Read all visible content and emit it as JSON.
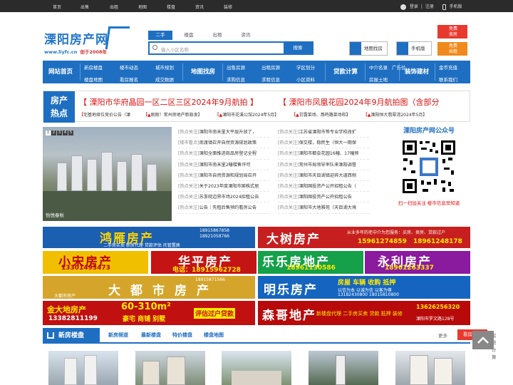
{
  "topnav": {
    "items": [
      "首页",
      "出售",
      "出租",
      "地图",
      "楼盘",
      "资讯",
      "装修"
    ],
    "login": "登录",
    "sep": "|",
    "register": "注册",
    "mobile": "手机版"
  },
  "logo": {
    "title": "溧阳房产网",
    "url": "www.liyfc.cn",
    "founded": "创于2008年"
  },
  "search": {
    "tabs": [
      "二手",
      "楼盘",
      "出租",
      "资讯"
    ],
    "placeholder": "输入小区名称",
    "button": "搜索"
  },
  "header_buttons": {
    "map": "地图找房",
    "mobile": "手机版",
    "free_sell": "免费\n卖房",
    "free_rent": "免费\n出租",
    "free_sell_a": "免费",
    "free_sell_b": "卖房",
    "free_rent_a": "免费",
    "free_rent_b": "出租"
  },
  "mainnav": {
    "home": "网站首页",
    "newhouse": [
      "新房楼盘",
      "楼盘地图"
    ],
    "dynamic": [
      "楼市动态",
      "看房报名"
    ],
    "city": [
      "城市规划",
      "成交数据"
    ],
    "mapfind": "地图找房",
    "sale": [
      "出售房源",
      "求购信息"
    ],
    "rent": [
      "出租房源",
      "求租信息"
    ],
    "school": [
      "学区划分",
      "小区资料"
    ],
    "loan": "贷款计算",
    "agency": [
      "中介名录",
      "广告位"
    ],
    "agency2": "房屋土地",
    "decor": "装饰建材",
    "others": [
      "金币充值",
      "联系我们"
    ]
  },
  "hot": {
    "label1": "房产",
    "label2": "热点",
    "headline1": "【 溧阳市华府晶园一区二区三区2024年9月航拍 】",
    "headline2": "【 溧阳市凤凰花园2024年9月航拍图（含部分",
    "links": [
      {
        "tag": "【",
        "text": "宅基地择位竞价公告（溧"
      },
      {
        "tag": "【▲",
        "text": "刚刚！常州房地产新政发】"
      },
      {
        "tag": "【▲",
        "text": "溧阳市花溪公馆2024年5月】"
      },
      {
        "tag": "【▲",
        "text": "甘露菜场、燕鸣路菜场和】"
      },
      {
        "tag": "【▲",
        "text": "溧阳恒大翡翠湾2024年5月】"
      }
    ]
  },
  "slider": {
    "pages": [
      "1",
      "2",
      "3",
      "4",
      "5"
    ],
    "caption": "怡悦春秋"
  },
  "news_left": [
    {
      "tag": "[热点关注]",
      "text": "溧阳市南禾里大平层升放了，"
    },
    {
      "tag": "[楼市看点]",
      "text": "南渡镇召开自然资源规划政策"
    },
    {
      "tag": "[热点关注]",
      "text": "溧阳全面推进商品房登记全程"
    },
    {
      "tag": "[热点关注]",
      "text": "溧阳市南禾里2幢楼售许可"
    },
    {
      "tag": "[热点关注]",
      "text": "溧阳市自然资源和规划局召开"
    },
    {
      "tag": "[热点关注]",
      "text": "关于2023年度溧阳市国株式居"
    },
    {
      "tag": "[热点关注]",
      "text": "苏浙皖边界市场2024招租公告"
    },
    {
      "tag": "[热点关注]",
      "text": "公告｜先租后售预约看房公告"
    }
  ],
  "news_right": [
    {
      "tag": "[热点关注]",
      "text": "江苏省溧阳市等专业学校改扩"
    },
    {
      "tag": "[热点关注]",
      "text": "保交楼，稳民生（恒大一期保"
    },
    {
      "tag": "[热点关注]",
      "text": "溧阳市都会花园16幢、17幢预"
    },
    {
      "tag": "[热点关注]",
      "text": "常州市局领导率队来溧阳调督"
    },
    {
      "tag": "[热点关注]",
      "text": "溧阳市天目湖镇迎宾大道西侧"
    },
    {
      "tag": "[热点关注]",
      "text": "溧阳国投资产公开招租公告（"
    },
    {
      "tag": "[热点关注]",
      "text": "溧阳国投资产公开招租公告"
    },
    {
      "tag": "[热点关注]",
      "text": "溧阳市大地雅苑（天目湖大境"
    }
  ],
  "wechat": {
    "title": "溧阳房产网公众号",
    "caption": "扫一扫加关注  楼市信息早知道"
  },
  "ads": {
    "a1": {
      "name": "鸿雁房产",
      "p1": "18915867858",
      "p2": "18921058766",
      "tag": "二手房买卖 新房代理 贷款评估 托管置换"
    },
    "a2": {
      "name": "大树房产",
      "desc": "从业多年的老中介为您服务：买房、卖房、贷款过户",
      "p1": "15961274859",
      "p2": "18961248178"
    },
    "a3": {
      "name": "小宋房产",
      "p": "13301493473"
    },
    "a4": {
      "name": "华平房产",
      "p": "电话：18915962728"
    },
    "a5": {
      "name": "乐乐房地产",
      "p": "18961130586"
    },
    "a6": {
      "name": "永利房产",
      "p": "18961263337"
    },
    "a7": {
      "name": "大都市房产",
      "sub": "大都市房产",
      "p": "18915871566"
    },
    "a8": {
      "name": "明乐房产",
      "desc": "房屋 车辆 收购 抵押",
      "p1": "以信为本  以诚为信  以客为尊",
      "p2": "13182430800 18015810800"
    },
    "a9": {
      "name": "金大地房产",
      "size": "60-310m²",
      "types": "豪宅 商铺 别墅",
      "cta": "评估过户贷款",
      "p": "13382811199"
    },
    "a10": {
      "name": "森哥地产",
      "desc": "新楼盘代理 二手房买卖 贷款 抵押 装修",
      "p": "13626256320",
      "addr": "溧阳市罗文路128号"
    }
  },
  "newhouse": {
    "label": "新房楼盘",
    "tabs": [
      "新房频道",
      "最新楼盘",
      "特价楼盘",
      "楼盘地图"
    ],
    "more": "更多",
    "report": "看房报名",
    "calc": "房贷计算"
  }
}
